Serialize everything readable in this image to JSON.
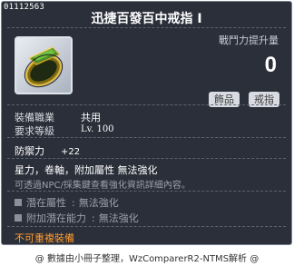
{
  "item": {
    "id": "01112563",
    "name": "迅捷百發百中戒指 I",
    "icon": "green-gold-ring-icon"
  },
  "stat_header": {
    "label": "戰鬥力提升量",
    "value": "0"
  },
  "tags": [
    "飾品",
    "戒指"
  ],
  "requirements": [
    {
      "label": "裝備職業",
      "value": "共用"
    },
    {
      "label": "要求等級",
      "value": "Lv. 100"
    }
  ],
  "stats": [
    {
      "label": "防禦力",
      "value": "+22"
    }
  ],
  "description": {
    "line1": "星力，卷軸，附加屬性 無法強化",
    "line2": "可透過NPC/採集鍵查看強化資訊詳細內容。"
  },
  "potentials": [
    {
      "label": "潛在屬性",
      "value": "無法強化"
    },
    {
      "label": "附加潛在能力",
      "value": "無法強化"
    }
  ],
  "warning": "不可重複裝備",
  "footer": "@ 數據由小冊子整理，WzComparerR2-NTMS解析 @",
  "colors": {
    "background": "#2b2f3a",
    "warning": "#ff9b2e",
    "muted": "#9aa0ac"
  }
}
